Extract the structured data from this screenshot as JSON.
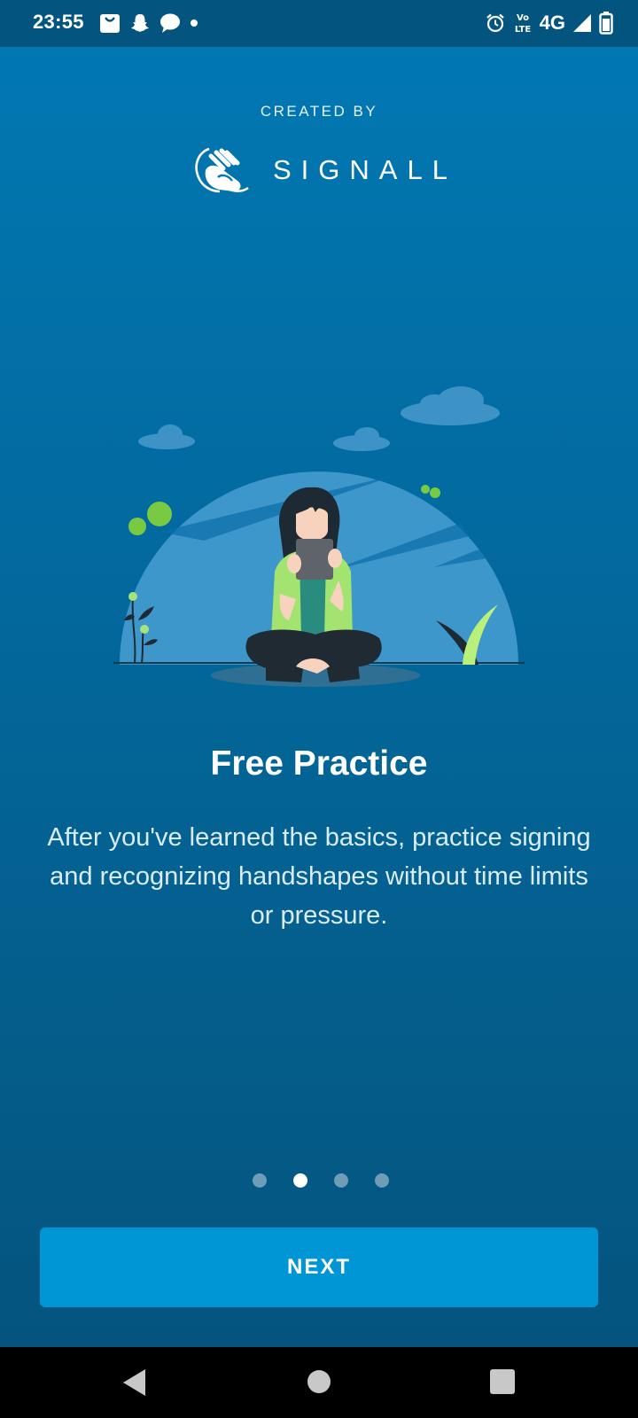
{
  "status_bar": {
    "time": "23:55",
    "network": "4G",
    "volte": "Vo LTE",
    "left_icons": [
      "shopping-bag-icon",
      "snapchat-icon",
      "chat-bubble-icon",
      "notification-dot-icon"
    ],
    "right_icons": [
      "alarm-icon",
      "volte-icon",
      "signal-icon",
      "battery-icon"
    ]
  },
  "header": {
    "created_by": "CREATED BY",
    "brand_name": "SIGNALL",
    "logo_icon": "signall-hands-logo-icon"
  },
  "slide": {
    "illustration": "woman-sitting-with-tablet-illustration",
    "title": "Free Practice",
    "description": "After you've learned the basics, practice signing and recognizing handshapes without time limits or pressure."
  },
  "pager": {
    "total": 4,
    "active_index": 1
  },
  "actions": {
    "next_label": "NEXT"
  },
  "nav_bar": {
    "icons": [
      "back-icon",
      "home-icon",
      "recents-icon"
    ]
  },
  "colors": {
    "background_top": "#0179b4",
    "background_bottom": "#04527c",
    "button": "#0096d6",
    "accent_green": "#7ac943"
  }
}
